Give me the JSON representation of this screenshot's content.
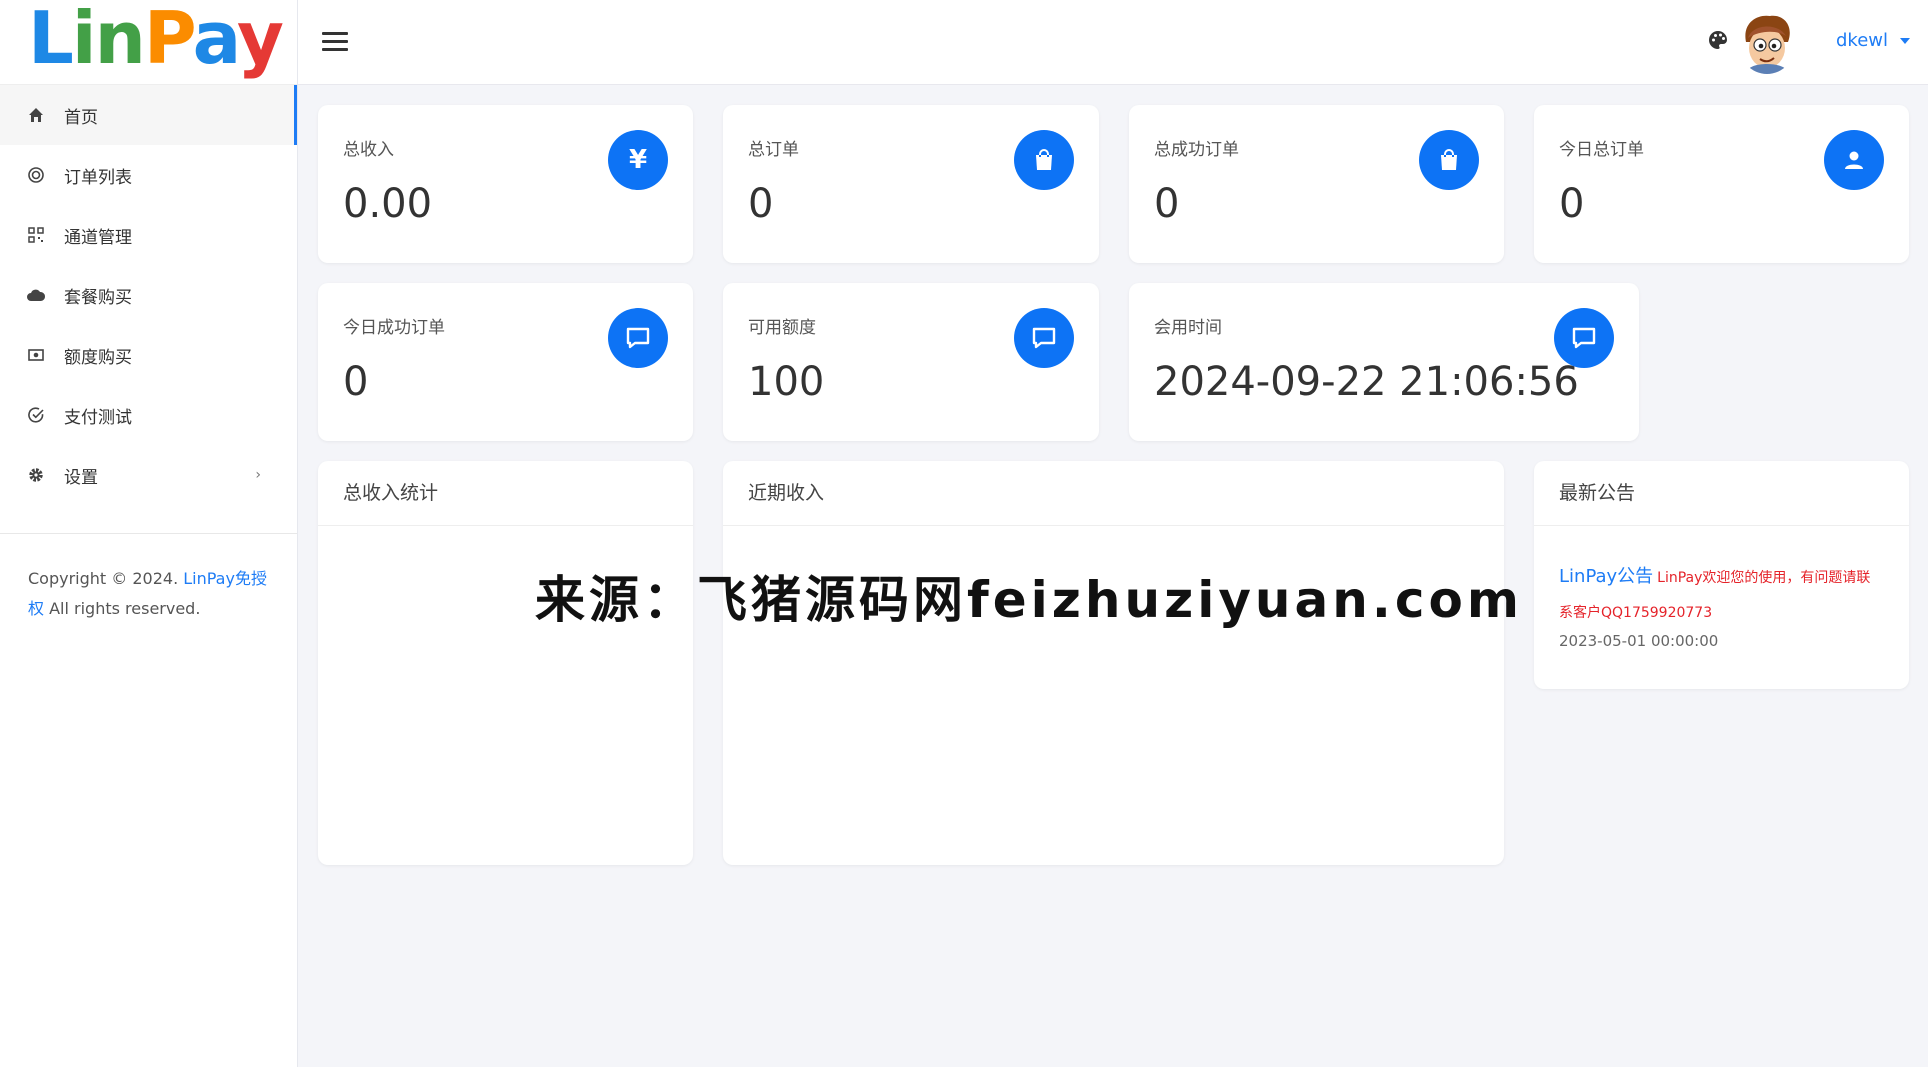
{
  "logo": {
    "letters": [
      "L",
      "in",
      "P",
      "a",
      "y"
    ]
  },
  "sidebar": {
    "items": [
      {
        "label": "首页",
        "icon": "home-icon"
      },
      {
        "label": "订单列表",
        "icon": "target-icon"
      },
      {
        "label": "通道管理",
        "icon": "qrcode-icon"
      },
      {
        "label": "套餐购买",
        "icon": "cloud-icon"
      },
      {
        "label": "额度购买",
        "icon": "money-icon"
      },
      {
        "label": "支付测试",
        "icon": "check-circle-icon"
      },
      {
        "label": "设置",
        "icon": "gear-icon"
      }
    ],
    "copyright_prefix": "Copyright © 2024. ",
    "copyright_link": "LinPay免授权",
    "copyright_suffix": " All rights reserved."
  },
  "header": {
    "username": "dkewl"
  },
  "stats": [
    {
      "label": "总收入",
      "value": "0.00",
      "icon": "yen-icon"
    },
    {
      "label": "总订单",
      "value": "0",
      "icon": "shopping-bag-icon"
    },
    {
      "label": "总成功订单",
      "value": "0",
      "icon": "shopping-bag-icon"
    },
    {
      "label": "今日总订单",
      "value": "0",
      "icon": "user-icon"
    },
    {
      "label": "今日成功订单",
      "value": "0",
      "icon": "message-icon"
    },
    {
      "label": "可用额度",
      "value": "100",
      "icon": "message-icon"
    },
    {
      "label": "会用时间",
      "value": "2024-09-22 21:06:56",
      "icon": "message-icon"
    }
  ],
  "panels": {
    "total_income_stats": "总收入统计",
    "recent_income": "近期收入",
    "latest_notice": "最新公告"
  },
  "notice": {
    "title": "LinPay公告",
    "body": "LinPay欢迎您的使用，有问题请联系客户QQ1759920773",
    "date": "2023-05-01 00:00:00"
  },
  "watermark": "来源：飞猪源码网feizhuziyuan.com",
  "colors": {
    "accent": "#0d73f5",
    "link": "#1e7cf5",
    "notice_red": "#e5232a"
  }
}
